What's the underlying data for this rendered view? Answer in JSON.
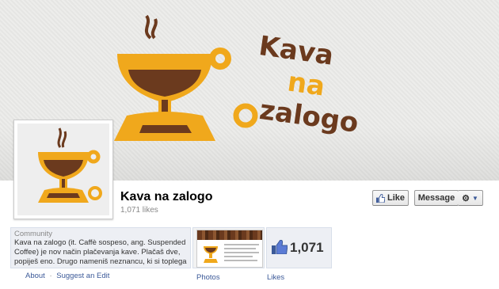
{
  "cover": {
    "logo_line1": "Kava",
    "logo_line2": "na",
    "logo_line3": "zalogo",
    "colors": {
      "brand_brown": "#6b3a1e",
      "brand_yellow": "#f0a81c"
    }
  },
  "header": {
    "page_name": "Kava na zalogo",
    "likes_text": "1,071 likes"
  },
  "actions": {
    "like_label": "Like",
    "message_label": "Message",
    "gear_icon": "gear-icon",
    "dropdown_icon": "chevron-down-icon"
  },
  "about": {
    "category": "Community",
    "description": "Kava na zalogo (it. Caffè sospeso, ang. Suspended Coffee) je nov način plačevanja kave. Plačaš dve, popiješ eno. Drugo nameniš neznancu, ki si toplega",
    "about_link": "About",
    "separator": "·",
    "suggest_link": "Suggest an Edit"
  },
  "tiles": {
    "photos_label": "Photos",
    "likes_label": "Likes",
    "likes_count": "1,071"
  }
}
